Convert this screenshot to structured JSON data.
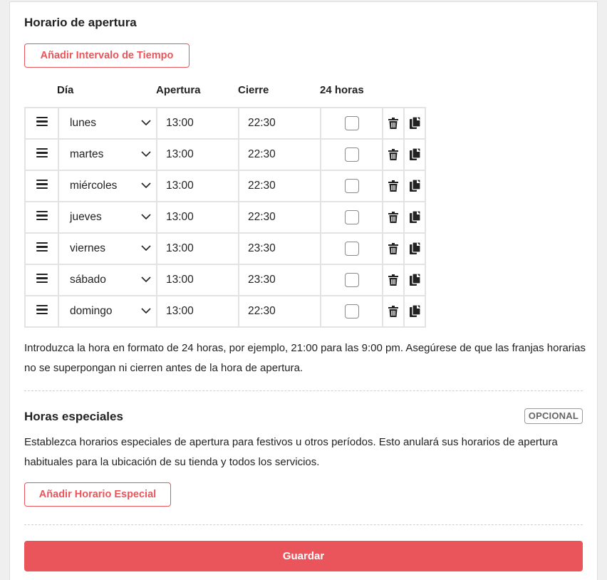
{
  "opening_hours": {
    "title": "Horario de apertura",
    "add_interval_label": "Añadir Intervalo de Tiempo",
    "columns": {
      "day": "Día",
      "open": "Apertura",
      "close": "Cierre",
      "all_day": "24 horas"
    },
    "rows": [
      {
        "day": "lunes",
        "open": "13:00",
        "close": "22:30",
        "all_day": false
      },
      {
        "day": "martes",
        "open": "13:00",
        "close": "22:30",
        "all_day": false
      },
      {
        "day": "miércoles",
        "open": "13:00",
        "close": "22:30",
        "all_day": false
      },
      {
        "day": "jueves",
        "open": "13:00",
        "close": "22:30",
        "all_day": false
      },
      {
        "day": "viernes",
        "open": "13:00",
        "close": "23:30",
        "all_day": false
      },
      {
        "day": "sábado",
        "open": "13:00",
        "close": "23:30",
        "all_day": false
      },
      {
        "day": "domingo",
        "open": "13:00",
        "close": "22:30",
        "all_day": false
      }
    ],
    "help_text": "Introduzca la hora en formato de 24 horas, por ejemplo, 21:00 para las 9:00 pm. Asegúrese de que las franjas horarias no se superpongan ni cierren antes de la hora de apertura."
  },
  "special_hours": {
    "title": "Horas especiales",
    "badge": "OPCIONAL",
    "description": "Establezca horarios especiales de apertura para festivos u otros períodos. Esto anulará sus horarios de apertura habituales para la ubicación de su tienda y todos los servicios.",
    "add_label": "Añadir Horario Especial"
  },
  "footer": {
    "save_label": "Guardar"
  },
  "colors": {
    "accent": "#e9555b",
    "border": "#e3e3e3",
    "text": "#222222"
  }
}
